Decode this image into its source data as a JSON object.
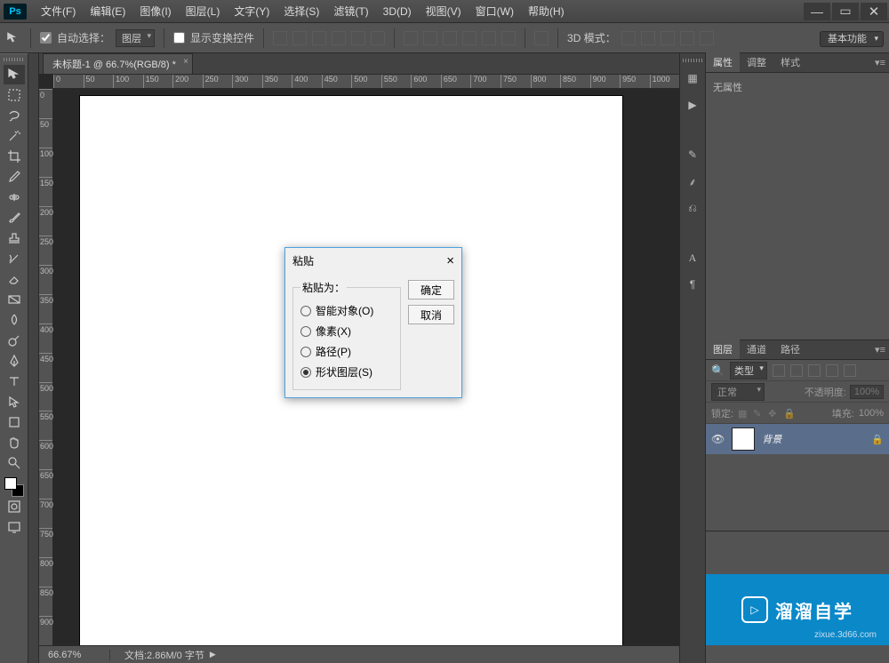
{
  "app": {
    "icon_text": "Ps"
  },
  "menu": [
    "文件(F)",
    "编辑(E)",
    "图像(I)",
    "图层(L)",
    "文字(Y)",
    "选择(S)",
    "滤镜(T)",
    "3D(D)",
    "视图(V)",
    "窗口(W)",
    "帮助(H)"
  ],
  "options_bar": {
    "auto_select_label": "自动选择：",
    "auto_select_value": "图层",
    "show_transform_label": "显示变换控件",
    "mode_3d_label": "3D 模式：",
    "workspace": "基本功能"
  },
  "document": {
    "tab_title": "未标题-1 @ 66.7%(RGB/8) *",
    "ruler_h": [
      "0",
      "50",
      "100",
      "150",
      "200",
      "250",
      "300",
      "350",
      "400",
      "450",
      "500",
      "550",
      "600",
      "650",
      "700",
      "750",
      "800",
      "850",
      "900",
      "950",
      "1000"
    ],
    "ruler_v": [
      "0",
      "50",
      "100",
      "150",
      "200",
      "250",
      "300",
      "350",
      "400",
      "450",
      "500",
      "550",
      "600",
      "650",
      "700",
      "750",
      "800",
      "850",
      "900"
    ]
  },
  "status": {
    "zoom": "66.67%",
    "doc_info": "文档:2.86M/0 字节"
  },
  "panels": {
    "top_tabs": [
      "属性",
      "调整",
      "样式"
    ],
    "no_props": "无属性",
    "layers_tabs": [
      "图层",
      "通道",
      "路径"
    ],
    "filter_label": "类型",
    "blend_mode": "正常",
    "opacity_label": "不透明度:",
    "opacity_value": "100%",
    "lock_label": "锁定:",
    "fill_label": "填充:",
    "fill_value": "100%",
    "layer_name": "背景"
  },
  "dialog": {
    "title": "粘贴",
    "group_label": "粘贴为：",
    "options": [
      "智能对象(O)",
      "像素(X)",
      "路径(P)",
      "形状图层(S)"
    ],
    "selected_index": 3,
    "ok": "确定",
    "cancel": "取消"
  },
  "watermark": {
    "brand": "溜溜自学",
    "url": "zixue.3d66.com"
  }
}
